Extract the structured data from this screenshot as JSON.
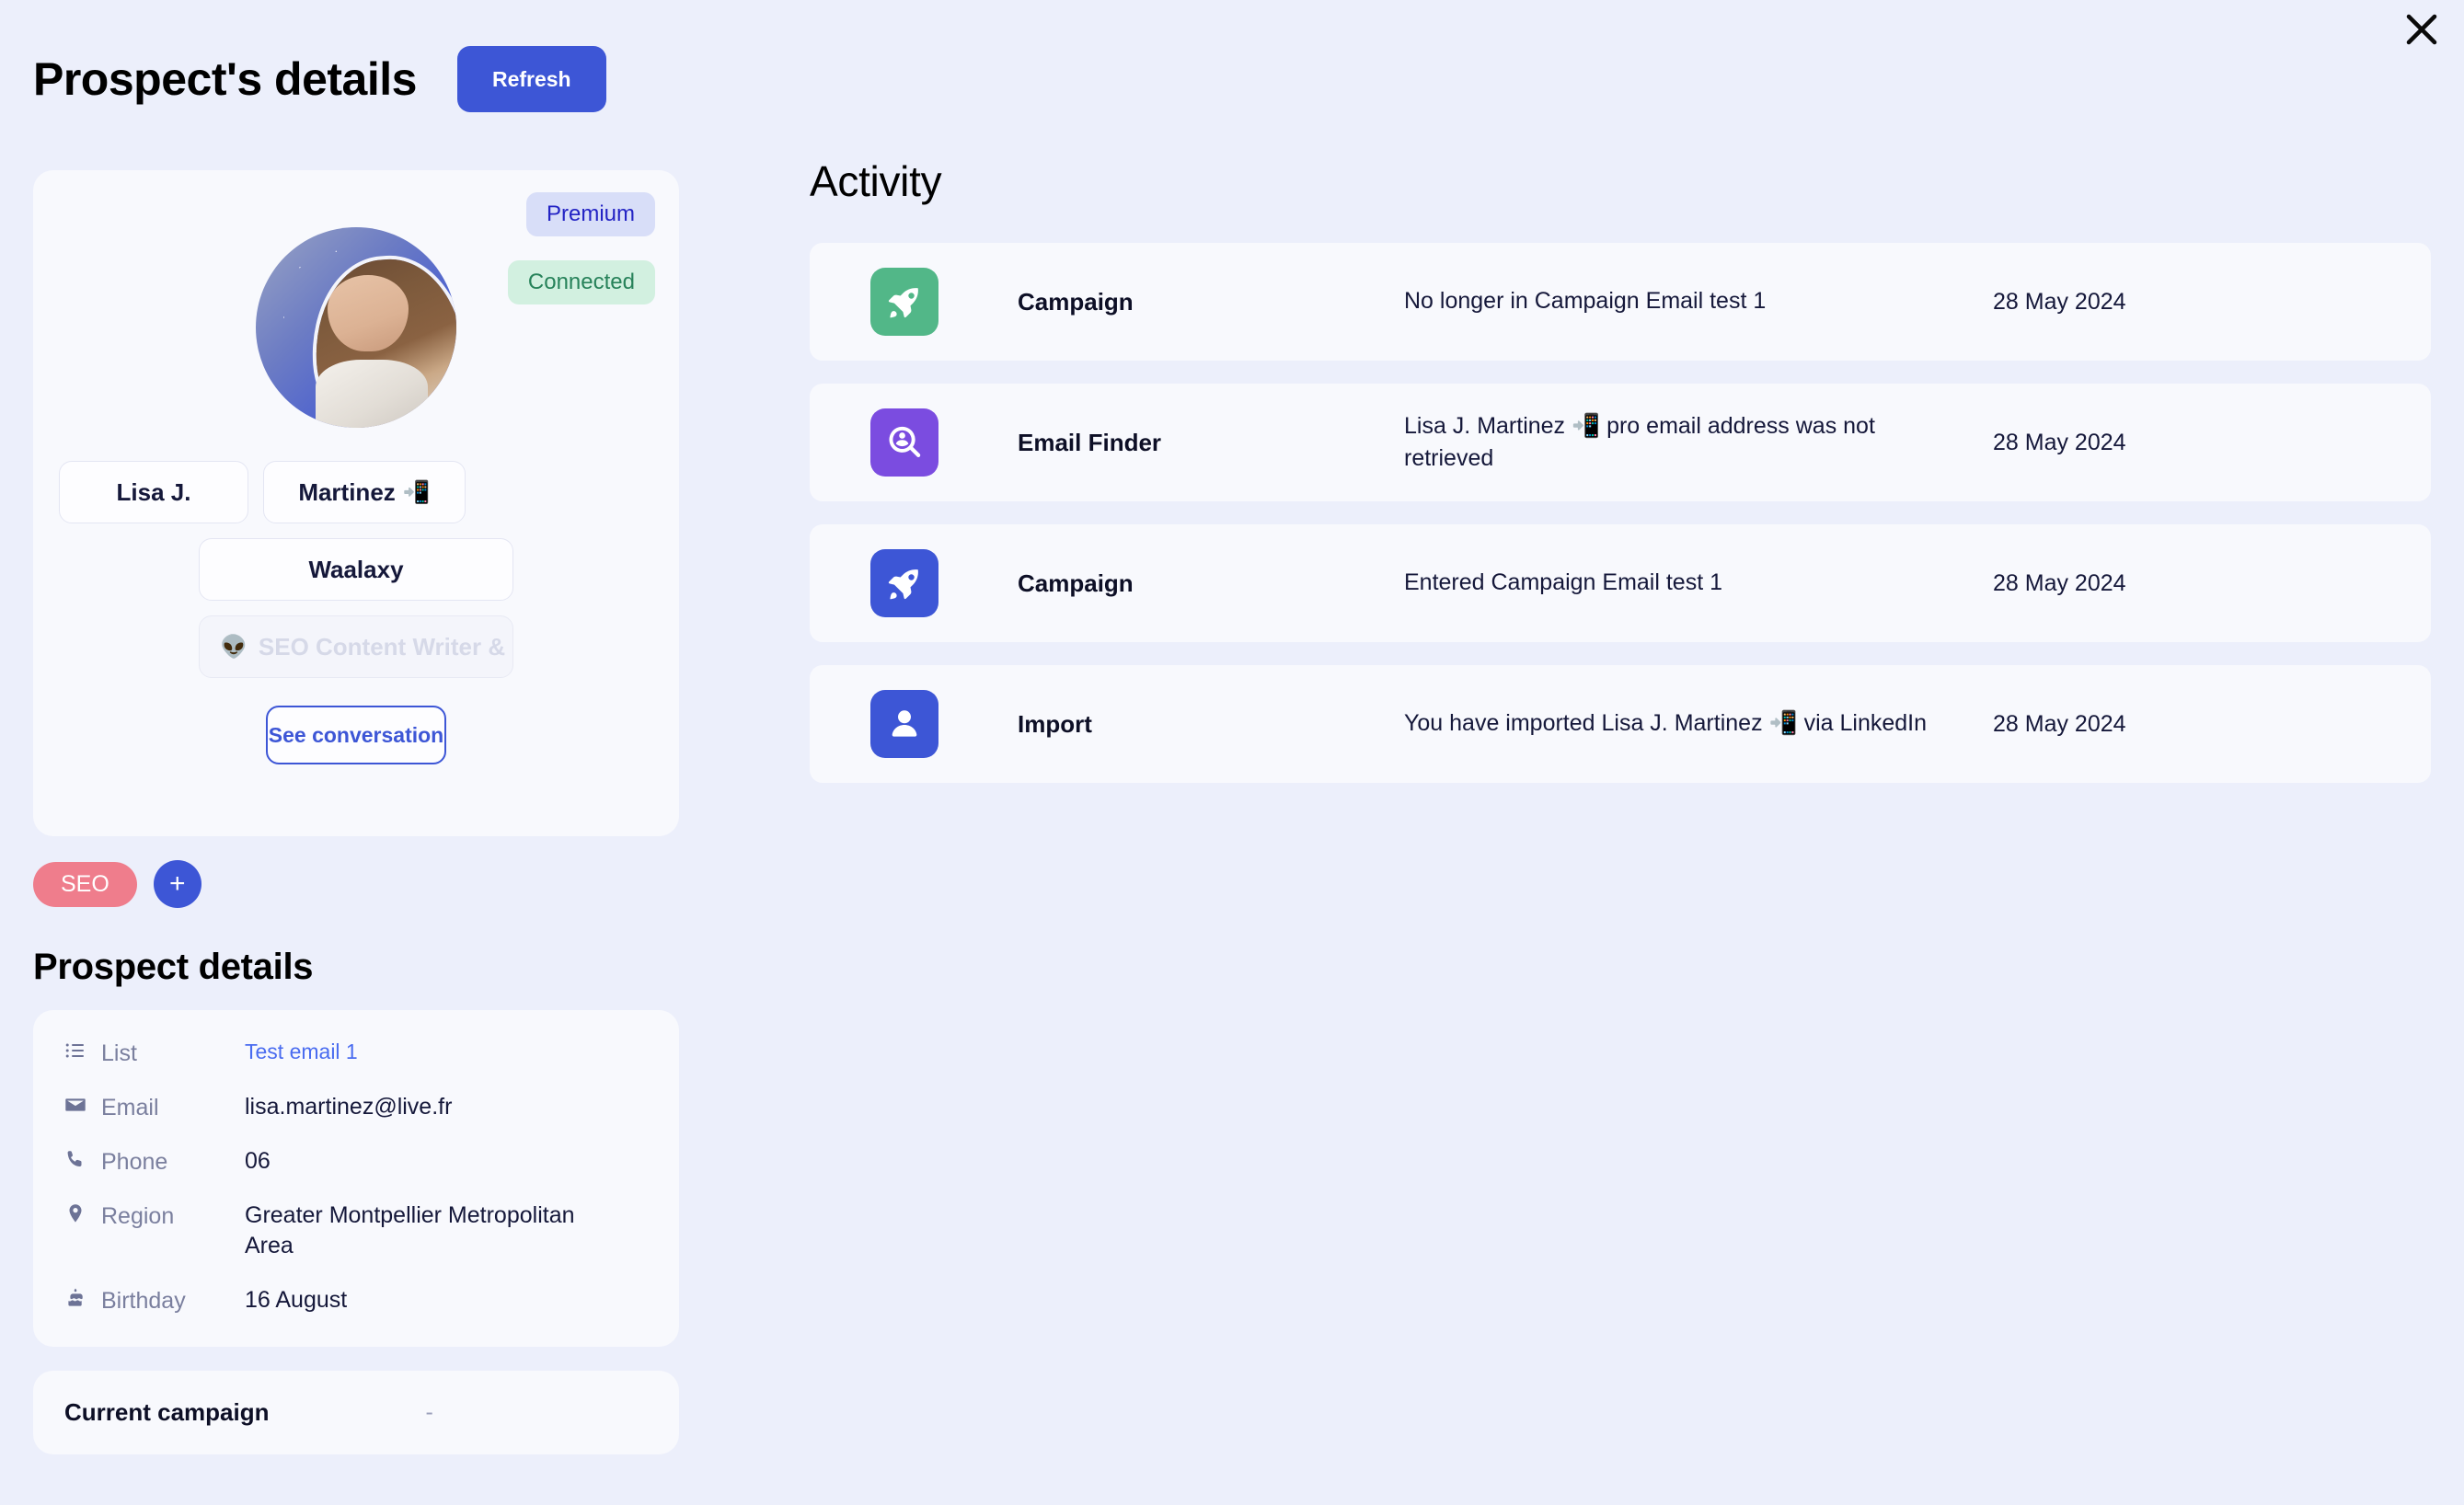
{
  "header": {
    "title": "Prospect's details",
    "refresh_label": "Refresh",
    "close_icon": "close-icon"
  },
  "profile": {
    "badges": {
      "premium": "Premium",
      "connected": "Connected"
    },
    "avatar_alt": "Lisa J. Martinez profile photo",
    "first_name": "Lisa J.",
    "last_name": "Martinez",
    "last_name_emoji": "📲",
    "company": "Waalaxy",
    "job_title_emoji": "👽",
    "job_title": "SEO Content Writer & ...",
    "see_conversation_label": "See conversation",
    "tags": [
      "SEO"
    ],
    "add_tag_label": "+"
  },
  "details": {
    "section_title": "Prospect details",
    "rows": [
      {
        "icon": "list-icon",
        "label": "List",
        "value": "Test email 1",
        "is_link": true
      },
      {
        "icon": "envelope-icon",
        "label": "Email",
        "value": "lisa.martinez@live.fr",
        "is_link": false
      },
      {
        "icon": "phone-icon",
        "label": "Phone",
        "value": "06",
        "is_link": false
      },
      {
        "icon": "pin-icon",
        "label": "Region",
        "value": "Greater Montpellier Metropolitan Area",
        "is_link": false
      },
      {
        "icon": "cake-icon",
        "label": "Birthday",
        "value": "16 August",
        "is_link": false
      }
    ]
  },
  "current_campaign": {
    "label": "Current campaign",
    "value": "-"
  },
  "activity": {
    "title": "Activity",
    "rows": [
      {
        "icon": "rocket-icon",
        "icon_color": "#52b788",
        "type": "Campaign",
        "description": "No longer in Campaign Email test 1",
        "date": "28 May 2024"
      },
      {
        "icon": "person-search-icon",
        "icon_color": "#7b4ce0",
        "type": "Email Finder",
        "description": "Lisa J. Martinez 📲 pro email address was not retrieved",
        "date": "28 May 2024"
      },
      {
        "icon": "rocket-icon",
        "icon_color": "#3d56d6",
        "type": "Campaign",
        "description": "Entered Campaign Email test 1",
        "date": "28 May 2024"
      },
      {
        "icon": "person-icon",
        "icon_color": "#3d56d6",
        "type": "Import",
        "description": "You have imported Lisa J. Martinez 📲 via LinkedIn",
        "date": "28 May 2024"
      }
    ]
  },
  "colors": {
    "page_bg": "#eceffb",
    "card_bg": "#f8f9fd",
    "accent": "#3d56d6",
    "tag_seo": "#ef7d8c",
    "badge_premium_bg": "#d8def8",
    "badge_premium_text": "#2323c4",
    "badge_connected_bg": "#d2f0e0",
    "badge_connected_text": "#27825a",
    "link": "#4a6cf0",
    "muted_text": "#7a7f9e"
  }
}
